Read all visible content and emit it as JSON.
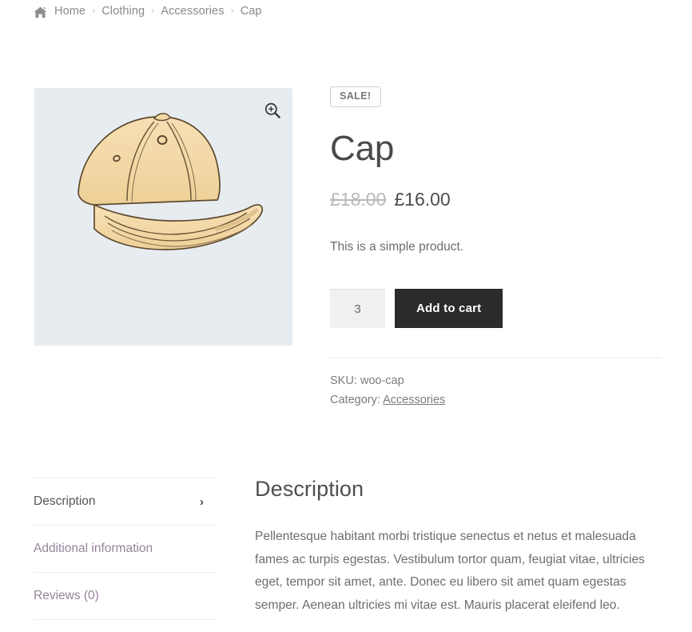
{
  "breadcrumb": {
    "home_icon": "home-icon",
    "separator": "›",
    "items": [
      {
        "label": "Home"
      },
      {
        "label": "Clothing"
      },
      {
        "label": "Accessories"
      },
      {
        "label": "Cap"
      }
    ]
  },
  "gallery": {
    "zoom_icon": "magnifier-plus-icon",
    "image_alt": "cap-illustration",
    "background_color": "#e7ecf1"
  },
  "product": {
    "sale_badge": "SALE!",
    "title": "Cap",
    "price_old": "£18.00",
    "price_new": "£16.00",
    "short_description": "This is a simple product.",
    "quantity": "3",
    "quantity_placeholder": "1",
    "add_to_cart_label": "Add to cart",
    "sku_label": "SKU:",
    "sku_value": "woo-cap",
    "category_label": "Category:",
    "category_value": "Accessories",
    "accent_color": "#2b2b2b"
  },
  "tabs": [
    {
      "label": "Description",
      "active": true,
      "chevron": "›"
    },
    {
      "label": "Additional information",
      "active": false,
      "chevron": ""
    },
    {
      "label": "Reviews (0)",
      "active": false,
      "chevron": ""
    }
  ],
  "panel": {
    "title": "Description",
    "body": "Pellentesque habitant morbi tristique senectus et netus et malesuada fames ac turpis egestas. Vestibulum tortor quam, feugiat vitae, ultricies eget, tempor sit amet, ante. Donec eu libero sit amet quam egestas semper. Aenean ultricies mi vitae est. Mauris placerat eleifend leo."
  }
}
